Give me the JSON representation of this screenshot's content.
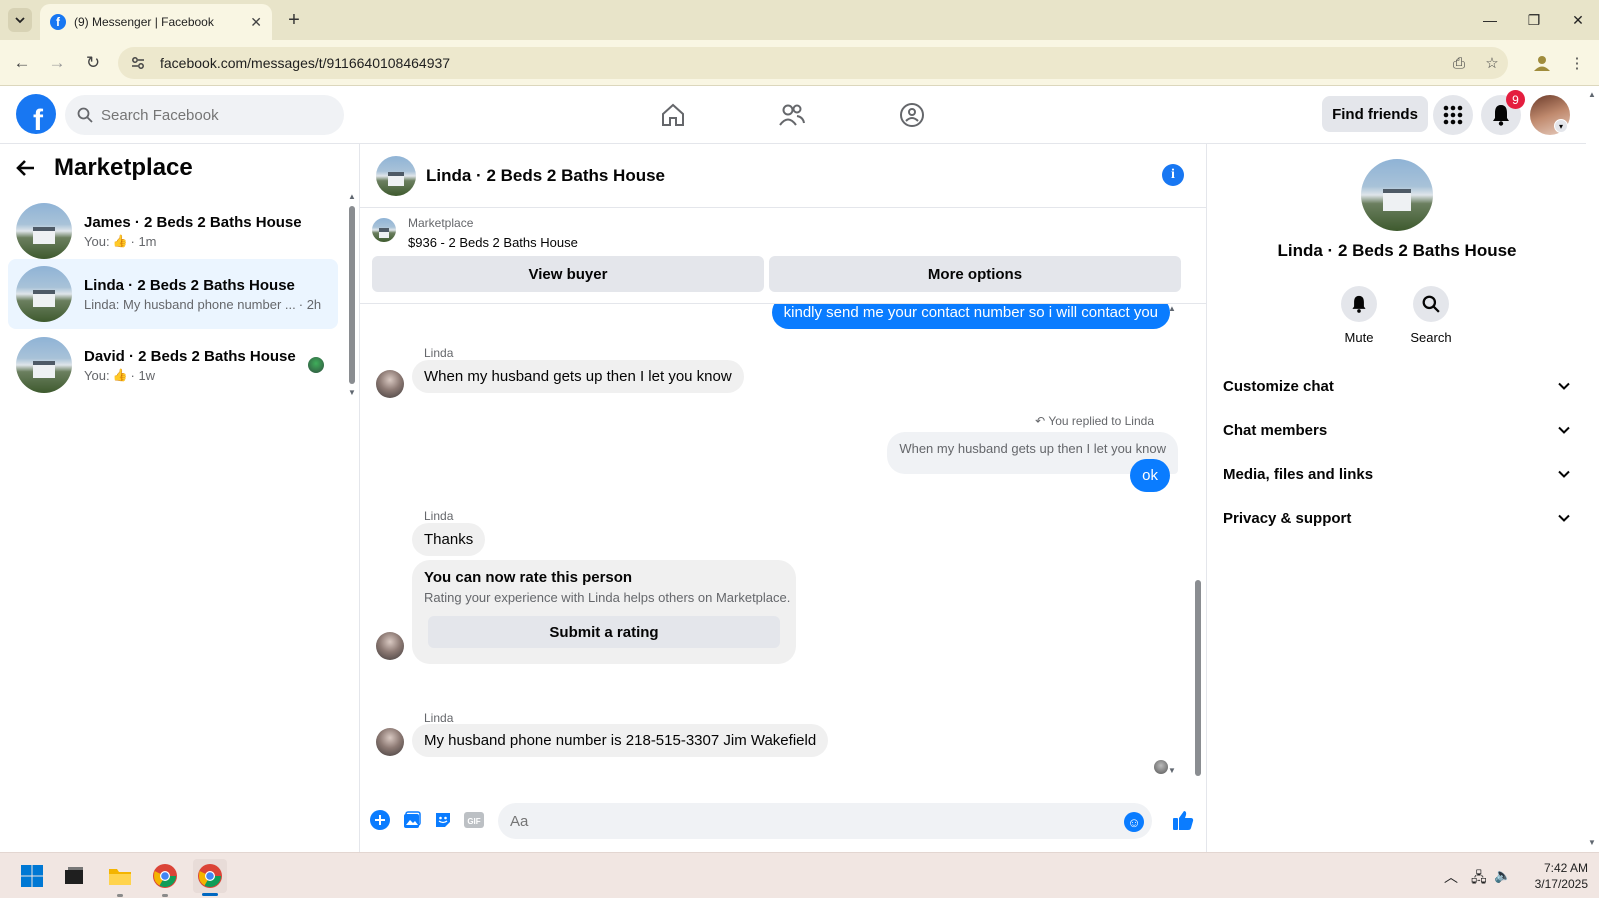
{
  "browser": {
    "tab_title": "(9) Messenger | Facebook",
    "url": "facebook.com/messages/t/9116640108464937"
  },
  "facebook": {
    "search_placeholder": "Search Facebook",
    "find_friends": "Find friends",
    "notification_count": "9",
    "brand_color": "#1877f2"
  },
  "sidebar": {
    "title": "Marketplace",
    "chats": [
      {
        "name": "James · 2 Beds 2 Baths House",
        "preview_prefix": "You:",
        "preview_icon": "like-icon",
        "time": "· 1m"
      },
      {
        "name": "Linda · 2 Beds 2 Baths House",
        "preview": "Linda: My husband phone number ...",
        "time": "· 2h"
      },
      {
        "name": "David · 2 Beds 2 Baths House",
        "preview_prefix": "You:",
        "preview_icon": "like-icon",
        "time": "· 1w"
      }
    ]
  },
  "conversation": {
    "title": "Linda · 2 Beds 2 Baths House",
    "marketplace_label": "Marketplace",
    "listing": "$936 - 2 Beds 2 Baths House",
    "view_buyer": "View buyer",
    "more_options": "More options",
    "messages": {
      "out_1": "kindly send me your contact number so i will contact you",
      "sender_1": "Linda",
      "in_1": "When my husband gets up then I let you know",
      "reply_note": "You replied to Linda",
      "quoted": "When my husband gets up then I let you know",
      "out_2": "ok",
      "sender_2": "Linda",
      "in_2": "Thanks",
      "rating_title": "You can now rate this person",
      "rating_sub": "Rating your experience with Linda helps others on Marketplace.",
      "rating_button": "Submit a rating",
      "sender_3": "Linda",
      "in_3": "My husband phone number is 218-515-3307 Jim Wakefield"
    },
    "composer_placeholder": "Aa",
    "message_blue": "#0a7cff"
  },
  "details": {
    "name": "Linda · 2 Beds 2 Baths House",
    "mute": "Mute",
    "search": "Search",
    "sections": [
      "Customize chat",
      "Chat members",
      "Media, files and links",
      "Privacy & support"
    ]
  },
  "taskbar": {
    "time": "7:42 AM",
    "date": "3/17/2025"
  }
}
